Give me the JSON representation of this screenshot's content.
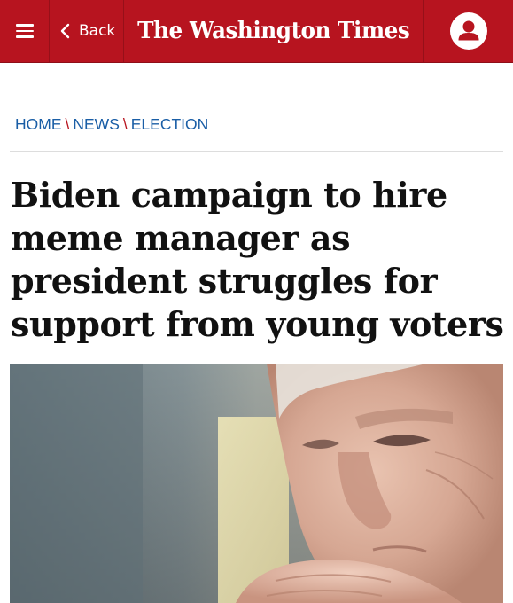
{
  "nav": {
    "menu_icon": "hamburger-icon",
    "back_label": "Back",
    "back_icon": "chevron-left-icon",
    "brand": "The Washington Times",
    "account_icon": "user-icon",
    "brand_color": "#b7141f"
  },
  "breadcrumb": {
    "items": [
      "HOME",
      "NEWS",
      "ELECTION"
    ],
    "separator": "\\",
    "link_color": "#1a5ea6"
  },
  "article": {
    "headline": "Biden campaign to hire meme manager as president struggles for support from young voters"
  }
}
